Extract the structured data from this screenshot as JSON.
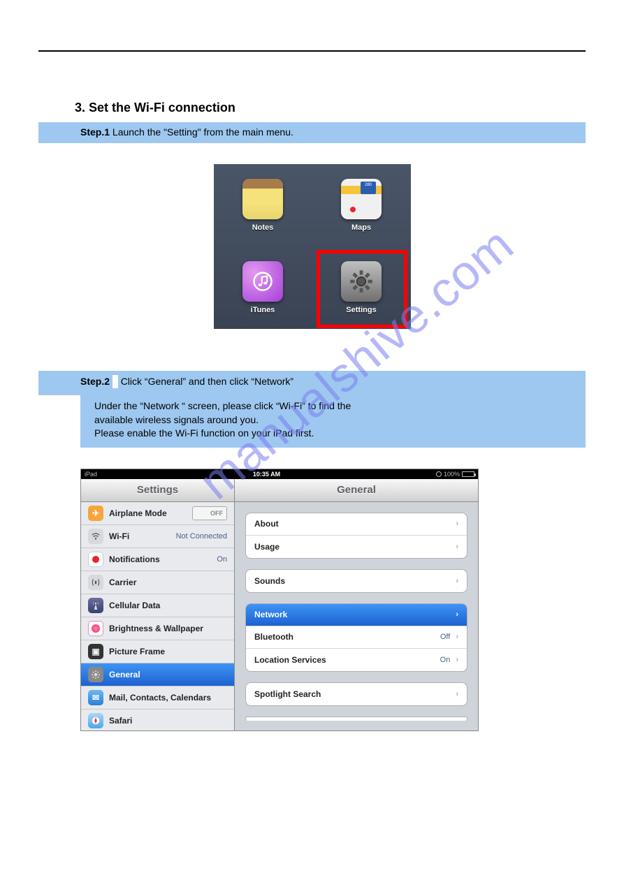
{
  "section_title": "3. Set the Wi-Fi connection",
  "step1": {
    "label": "Step.1",
    "text": " Launch the \"Setting\" from the main menu."
  },
  "home": {
    "apps": {
      "notes": "Notes",
      "maps": "Maps",
      "maps_sign": "280",
      "itunes": "iTunes",
      "settings": "Settings"
    }
  },
  "step2": {
    "label": "Step.2",
    "line1_after_label": "Click “General” and then click “Network”",
    "line2": "Under the “Network “ screen, please click “Wi-Fi” to find the",
    "line3": "available wireless signals around you.",
    "line4": "Please enable the Wi-Fi function on your iPad first."
  },
  "settings": {
    "statusbar": {
      "device": "iPad",
      "time": "10:35 AM",
      "battery": "100%"
    },
    "left_title": "Settings",
    "right_title": "General",
    "left": {
      "airplane": {
        "label": "Airplane Mode",
        "value": "OFF"
      },
      "wifi": {
        "label": "Wi-Fi",
        "value": "Not Connected"
      },
      "notifications": {
        "label": "Notifications",
        "value": "On"
      },
      "carrier": {
        "label": "Carrier"
      },
      "cellular": {
        "label": "Cellular Data"
      },
      "brightness": {
        "label": "Brightness & Wallpaper"
      },
      "frame": {
        "label": "Picture Frame"
      },
      "general": {
        "label": "General"
      },
      "mail": {
        "label": "Mail, Contacts, Calendars"
      },
      "safari": {
        "label": "Safari"
      }
    },
    "right": {
      "about": "About",
      "usage": "Usage",
      "sounds": "Sounds",
      "network": "Network",
      "bluetooth": {
        "label": "Bluetooth",
        "value": "Off"
      },
      "location": {
        "label": "Location Services",
        "value": "On"
      },
      "spotlight": "Spotlight Search"
    }
  },
  "watermark": "manualshive.com"
}
